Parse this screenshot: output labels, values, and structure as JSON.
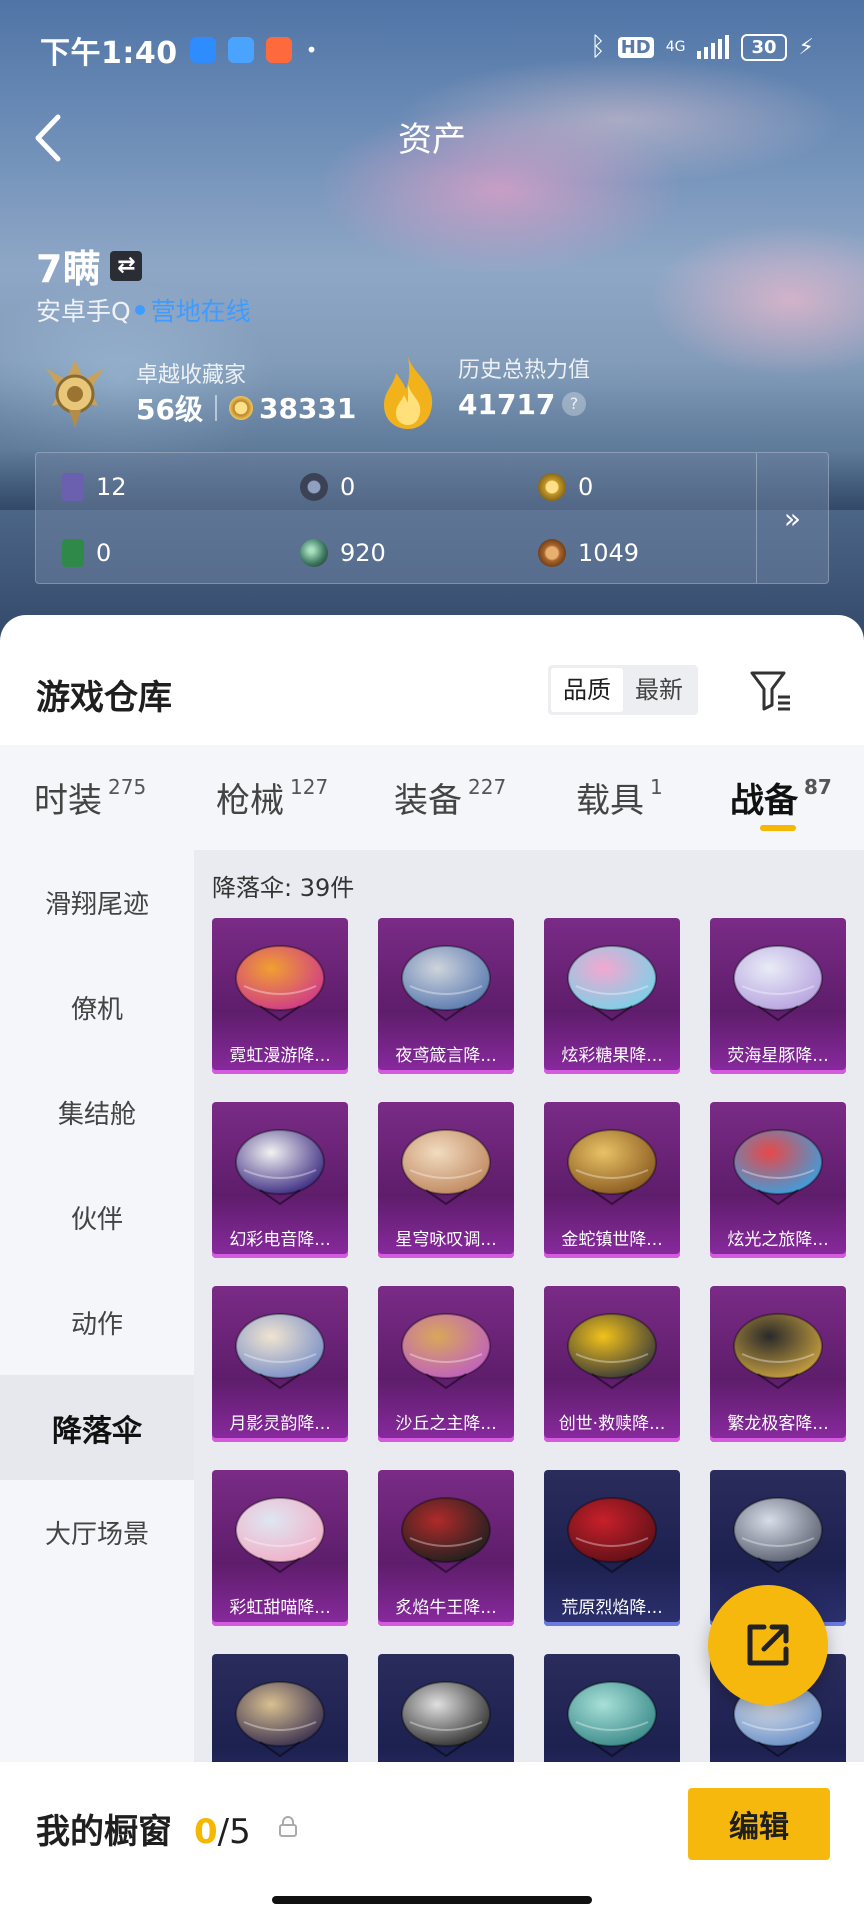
{
  "status_bar": {
    "time": "下午1:40",
    "network": "4G",
    "hd": "HD",
    "battery": "30"
  },
  "header": {
    "title": "资产"
  },
  "player": {
    "name": "7瞒",
    "platform": "安卓手Q",
    "status": "营地在线",
    "collector_title": "卓越收藏家",
    "level": "56级",
    "collector_points": "38331",
    "heat_label": "历史总热力值",
    "heat_value": "41717",
    "help": "?"
  },
  "currencies": [
    {
      "icon": "card-icon",
      "value": "12",
      "color": "#6b5fb0"
    },
    {
      "icon": "dark-coin-icon",
      "value": "0",
      "color": "#3b4256"
    },
    {
      "icon": "gold-coin-icon",
      "value": "0",
      "color": "#c49a2a"
    },
    {
      "icon": "green-card-icon",
      "value": "0",
      "color": "#2f8a4a"
    },
    {
      "icon": "green-orb-icon",
      "value": "920",
      "color": "#3f7b62"
    },
    {
      "icon": "bronze-coin-icon",
      "value": "1049",
      "color": "#a8652b"
    }
  ],
  "currency_more": "»",
  "warehouse": {
    "title": "游戏仓库",
    "sort": {
      "quality": "品质",
      "newest": "最新"
    }
  },
  "tabs": [
    {
      "label": "时装",
      "count": "275"
    },
    {
      "label": "枪械",
      "count": "127"
    },
    {
      "label": "装备",
      "count": "227"
    },
    {
      "label": "载具",
      "count": "1"
    },
    {
      "label": "战备",
      "count": "87"
    }
  ],
  "side_nav": [
    "滑翔尾迹",
    "僚机",
    "集结舱",
    "伙伴",
    "动作",
    "降落伞",
    "大厅场景"
  ],
  "category_count": "降落伞: 39件",
  "items": [
    {
      "name": "霓虹漫游降...",
      "rarity": "purple",
      "c1": "#f0a030",
      "c2": "#d03a8a"
    },
    {
      "name": "夜鸢箴言降...",
      "rarity": "purple",
      "c1": "#cfd4dc",
      "c2": "#5a7ab0"
    },
    {
      "name": "炫彩糖果降...",
      "rarity": "purple",
      "c1": "#f3a8d0",
      "c2": "#7ad0e8"
    },
    {
      "name": "荧海星豚降...",
      "rarity": "purple",
      "c1": "#e8ecf6",
      "c2": "#b7a2e0"
    },
    {
      "name": "幻彩电音降...",
      "rarity": "purple",
      "c1": "#f2f2f2",
      "c2": "#3a2a80"
    },
    {
      "name": "星穹咏叹调...",
      "rarity": "purple",
      "c1": "#f1dcc0",
      "c2": "#c08860"
    },
    {
      "name": "金蛇镇世降...",
      "rarity": "purple",
      "c1": "#e8c266",
      "c2": "#8a5a20"
    },
    {
      "name": "炫光之旅降...",
      "rarity": "purple",
      "c1": "#e84848",
      "c2": "#3aa0e0"
    },
    {
      "name": "月影灵韵降...",
      "rarity": "purple",
      "c1": "#f0e4d0",
      "c2": "#7a90c8"
    },
    {
      "name": "沙丘之主降...",
      "rarity": "purple",
      "c1": "#d8a858",
      "c2": "#c060c0"
    },
    {
      "name": "创世·救赎降...",
      "rarity": "purple",
      "c1": "#f2c21a",
      "c2": "#3a3a3a"
    },
    {
      "name": "繁龙极客降...",
      "rarity": "purple",
      "c1": "#2a2a2a",
      "c2": "#c8a040"
    },
    {
      "name": "彩虹甜喵降...",
      "rarity": "purple",
      "c1": "#dfe6f2",
      "c2": "#f0b0c8"
    },
    {
      "name": "炙焰牛王降...",
      "rarity": "purple",
      "c1": "#b02a2a",
      "c2": "#202020"
    },
    {
      "name": "荒原烈焰降...",
      "rarity": "blue",
      "c1": "#c8202a",
      "c2": "#601018"
    },
    {
      "name": "",
      "rarity": "blue",
      "c1": "#d8dde8",
      "c2": "#5a6070"
    },
    {
      "name": "",
      "rarity": "blue",
      "c1": "#d8c090",
      "c2": "#3a3050"
    },
    {
      "name": "",
      "rarity": "blue",
      "c1": "#e0e0e0",
      "c2": "#303030"
    },
    {
      "name": "",
      "rarity": "blue",
      "c1": "#a8e0d8",
      "c2": "#3a8a8a"
    },
    {
      "name": "",
      "rarity": "blue",
      "c1": "#e0e4ec",
      "c2": "#6a90c8"
    }
  ],
  "showcase": {
    "label": "我的橱窗",
    "current": "0",
    "total": "/5"
  },
  "edit_label": "编辑",
  "colors": {
    "accent": "#f6b80c",
    "online": "#3e9bff"
  }
}
